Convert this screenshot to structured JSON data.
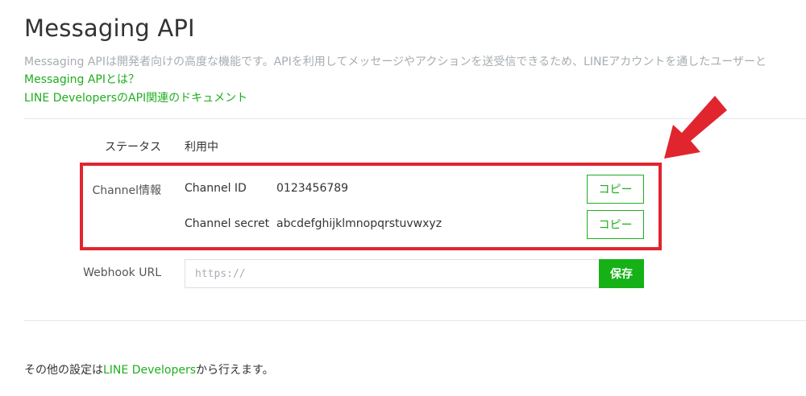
{
  "header": {
    "title": "Messaging API",
    "description": "Messaging APIは開発者向けの高度な機能です。APIを利用してメッセージやアクションを送受信できるため、LINEアカウントを通したユーザーと",
    "link_about": "Messaging APIとは？",
    "link_docs": "LINE DevelopersのAPI関連のドキュメント"
  },
  "status": {
    "label": "ステータス",
    "value": "利用中"
  },
  "channel_info": {
    "label": "Channel情報",
    "id_label": "Channel ID",
    "id_value": "0123456789",
    "secret_label": "Channel secret",
    "secret_value": "abcdefghijklmnopqrstuvwxyz",
    "copy_label": "コピー"
  },
  "webhook": {
    "label": "Webhook URL",
    "placeholder": "https://",
    "save_label": "保存"
  },
  "footer": {
    "prefix": "その他の設定は",
    "link": "LINE Developers",
    "suffix": "から行えます。"
  },
  "colors": {
    "accent_green": "#1fae1f",
    "save_green": "#16b116",
    "highlight_red": "#e0252f",
    "muted_text": "#a7adb2"
  },
  "icons": {
    "annotation": "arrow-pointer-icon"
  }
}
